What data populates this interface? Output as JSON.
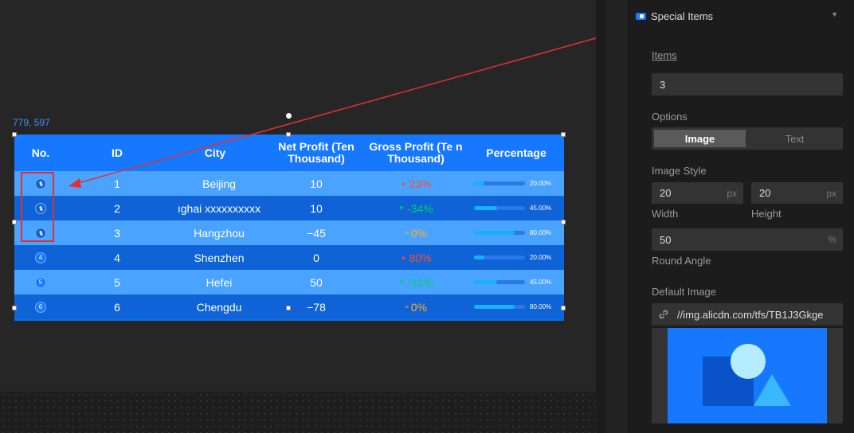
{
  "canvas": {
    "coord_label": "779, 597"
  },
  "table": {
    "headers": {
      "no": "No.",
      "id": "ID",
      "city": "City",
      "net_profit": "Net Profit (Ten Thousand)",
      "gross_profit": "Gross Profit (Te n Thousand)",
      "percentage": "Percentage"
    },
    "rows": [
      {
        "no": "",
        "id": "1",
        "city": "Beijing",
        "net": "10",
        "gross": "23%",
        "trend": "up",
        "pct": "20.00%",
        "fill": 0.2
      },
      {
        "no": "",
        "id": "2",
        "city": "ıghai xxxxxxxxxx",
        "net": "10",
        "gross": "-34%",
        "trend": "down",
        "pct": "45.00%",
        "fill": 0.45
      },
      {
        "no": "",
        "id": "3",
        "city": "Hangzhou",
        "net": "−45",
        "gross": "0%",
        "trend": "flat",
        "pct": "80.00%",
        "fill": 0.8
      },
      {
        "no": "4",
        "id": "4",
        "city": "Shenzhen",
        "net": "0",
        "gross": "80%",
        "trend": "up",
        "pct": "20.00%",
        "fill": 0.2
      },
      {
        "no": "5",
        "id": "5",
        "city": "Hefei",
        "net": "50",
        "gross": "-31%",
        "trend": "down",
        "pct": "45.00%",
        "fill": 0.45
      },
      {
        "no": "6",
        "id": "6",
        "city": "Chengdu",
        "net": "−78",
        "gross": "0%",
        "trend": "flat",
        "pct": "80.00%",
        "fill": 0.8
      }
    ],
    "trend_colors": {
      "up": "#ff4d2e",
      "down": "#00d06a",
      "flat": "#ffb020"
    }
  },
  "panel": {
    "section_title": "Special Items",
    "items_label": "Items",
    "items_value": "3",
    "options_label": "Options",
    "option_image": "Image",
    "option_text": "Text",
    "image_style_label": "Image Style",
    "width_value": "20",
    "height_value": "20",
    "unit_px": "px",
    "width_label": "Width",
    "height_label": "Height",
    "round_value": "50",
    "unit_pct": "%",
    "round_label": "Round Angle",
    "default_image_label": "Default Image",
    "default_image_url": "//img.alicdn.com/tfs/TB1J3Gkge"
  },
  "colors": {
    "accent": "#1677ff",
    "annotation": "#e23030"
  }
}
